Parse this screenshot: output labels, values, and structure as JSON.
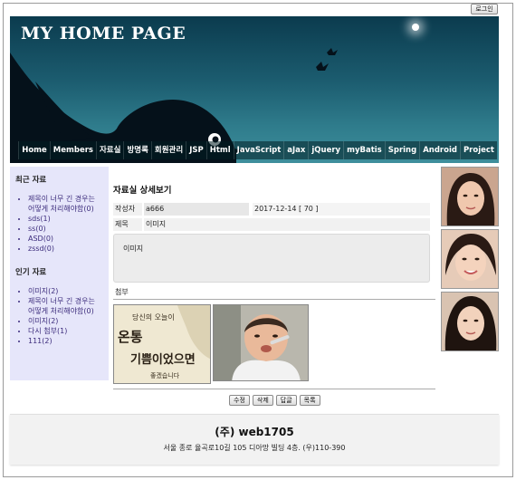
{
  "header": {
    "login_label": "로그인",
    "site_title": "MY HOME PAGE"
  },
  "nav": [
    "Home",
    "Members",
    "자료실",
    "방명록",
    "회원관리",
    "JSP",
    "Html",
    "JavaScript",
    "aJax",
    "jQuery",
    "myBatis",
    "Spring",
    "Android",
    "Project"
  ],
  "sidebar": {
    "recent_heading": "최근 자료",
    "recent_items": [
      "제목이 너무 긴 경우는 어떻게 처리해야함(0)",
      "sds(1)",
      "ss(0)",
      "ASD(0)",
      "zssd(0)"
    ],
    "popular_heading": "인기 자료",
    "popular_items": [
      "이미지(2)",
      "제목이 너무 긴 경우는 어떻게 처리해야함(0)",
      "이미지(2)",
      "다시 첨부(1)",
      "111(2)"
    ]
  },
  "detail": {
    "page_title": "자료실 상세보기",
    "writer_label": "작성자",
    "writer_value": "a666",
    "date_value": "2017-12-14 [ 70 ]",
    "title_label": "제목",
    "title_value": "이미지",
    "content": "이미지",
    "attach_label": "첨부",
    "attach1_caption": "당신의 오늘이 온통 기쁨이었으면 좋겠습니다",
    "buttons": [
      "수정",
      "삭제",
      "답글",
      "목록"
    ]
  },
  "footer": {
    "company": "(주) web1705",
    "address": "서울 종로 율곡로10길 105 디아망 빌딩 4층. (우)110-390"
  }
}
